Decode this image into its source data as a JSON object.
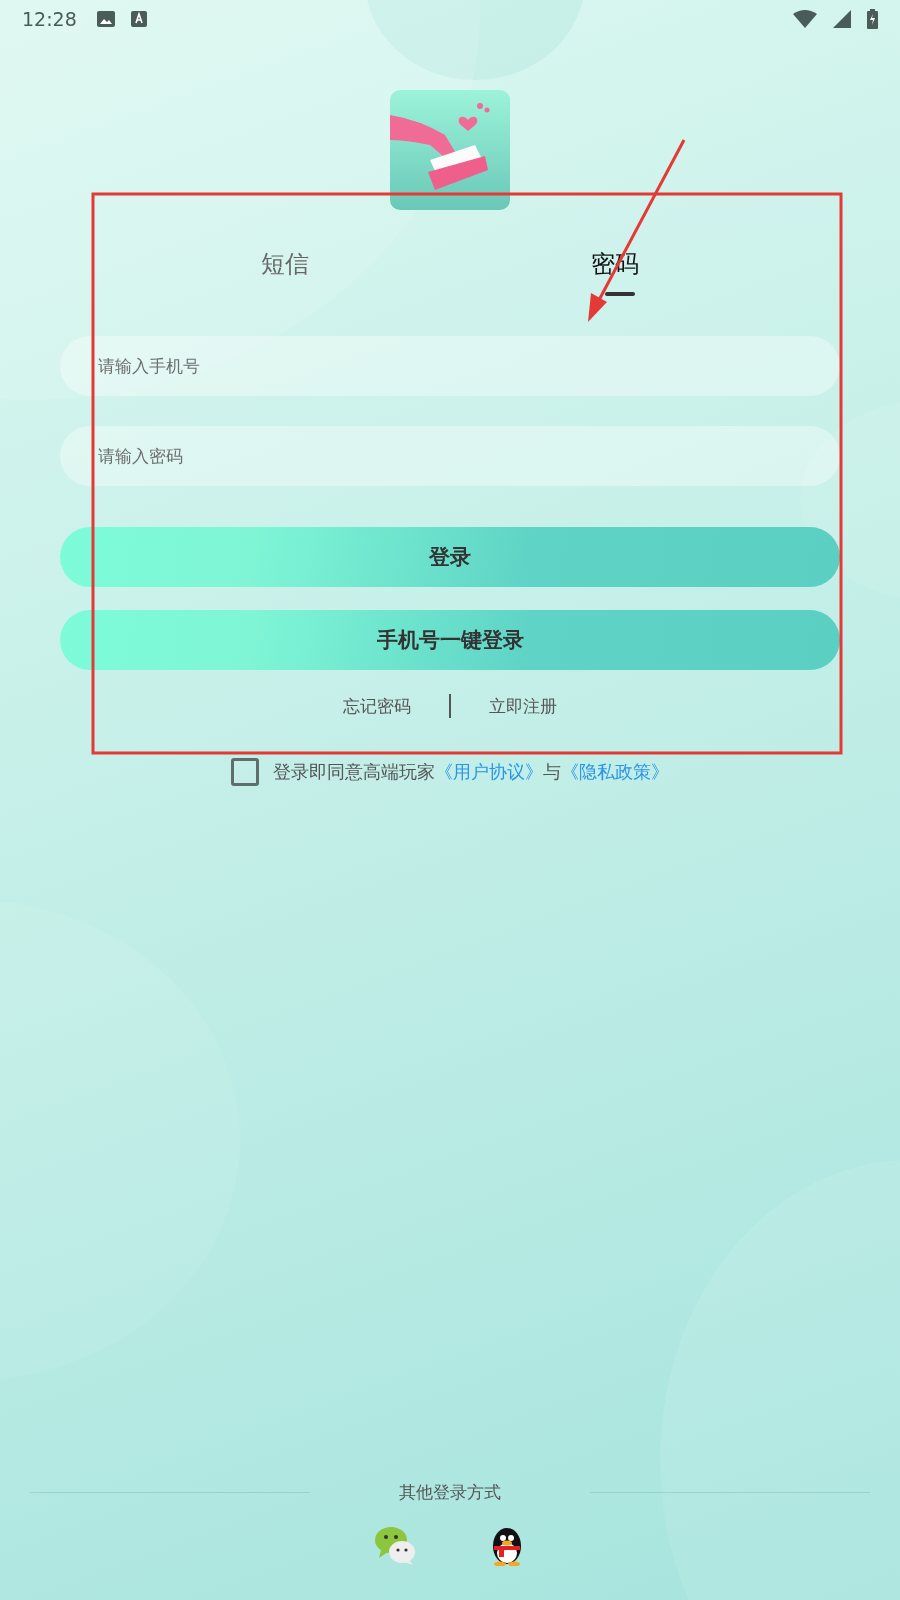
{
  "status_bar": {
    "time": "12:28"
  },
  "tabs": [
    {
      "label": "短信",
      "selected": false
    },
    {
      "label": "密码",
      "selected": true
    }
  ],
  "fields": [
    {
      "placeholder": "请输入手机号"
    },
    {
      "placeholder": "请输入密码"
    }
  ],
  "buttons": [
    "登录",
    "手机号一键登录"
  ],
  "links": [
    "忘记密码",
    "立即注册"
  ],
  "agreement": {
    "checked": false,
    "text": "登录即同意高端玩家",
    "link_1": "《用户协议》",
    "joiner": "与",
    "link_2": "《隐私政策》"
  },
  "other_login": {
    "label": "其他登录方式"
  }
}
